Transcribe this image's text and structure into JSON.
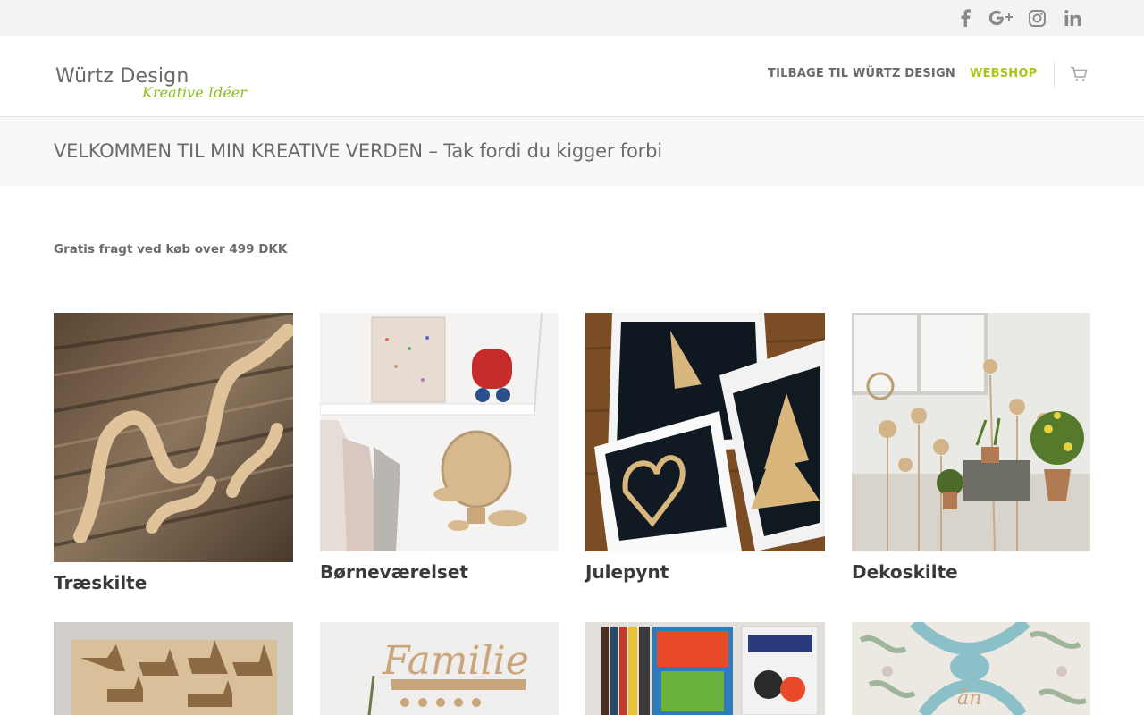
{
  "topbar": {
    "social": [
      {
        "name": "facebook-icon"
      },
      {
        "name": "google-plus-icon"
      },
      {
        "name": "instagram-icon"
      },
      {
        "name": "linkedin-icon"
      }
    ]
  },
  "header": {
    "logo_main": "Würtz Design",
    "logo_sub": "Kreative Idéer",
    "nav": [
      {
        "label": "TILBAGE TIL WÜRTZ DESIGN",
        "active": false
      },
      {
        "label": "WEBSHOP",
        "active": true
      }
    ],
    "cart_icon": "shopping-cart-icon",
    "accent_color": "#a8c51a"
  },
  "page": {
    "title": "VELKOMMEN TIL MIN KREATIVE VERDEN – Tak fordi du kigger forbi",
    "freight_notice": "Gratis fragt ved køb over 499 DKK"
  },
  "categories": [
    {
      "title": "Træskilte"
    },
    {
      "title": "Børneværelset"
    },
    {
      "title": "Julepynt"
    },
    {
      "title": "Dekoskilte"
    },
    {
      "title": ""
    },
    {
      "title": ""
    },
    {
      "title": ""
    },
    {
      "title": ""
    }
  ]
}
